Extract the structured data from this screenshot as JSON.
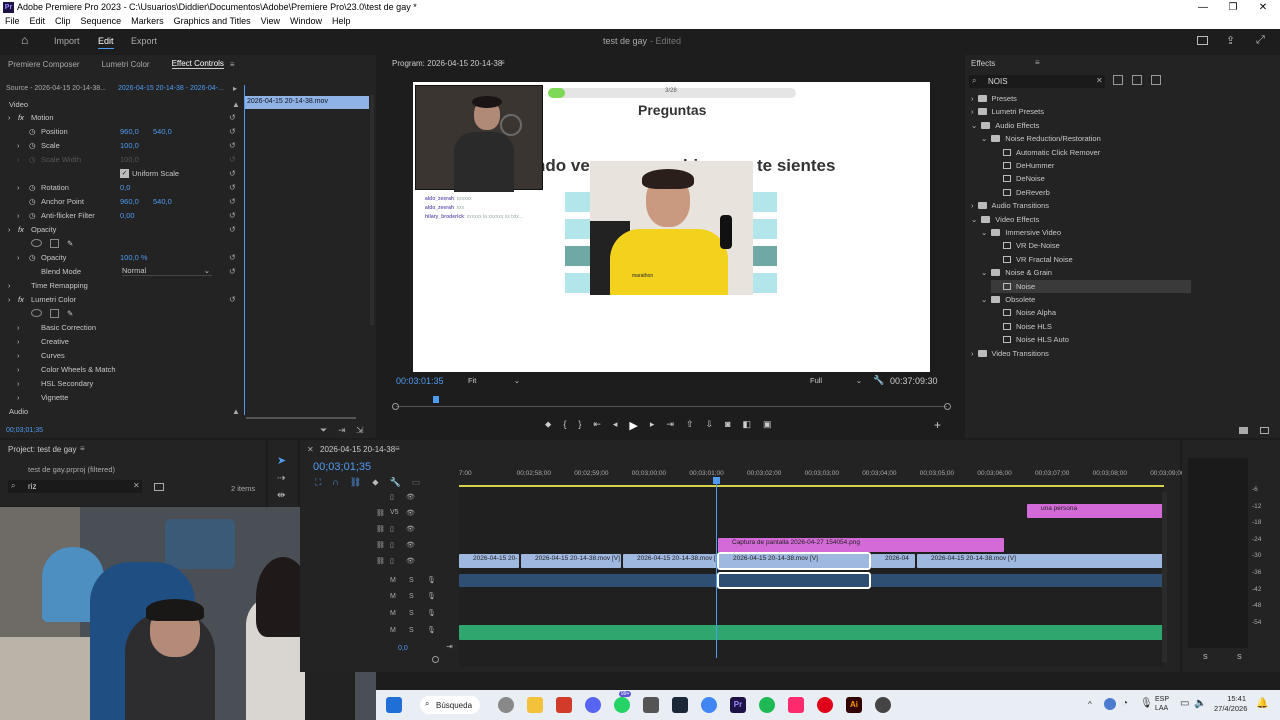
{
  "titlebar": {
    "title": "Adobe Premiere Pro 2023 - C:\\Usuarios\\Diddier\\Documentos\\Adobe\\Premiere Pro\\23.0\\test de gay *",
    "minimize": "—",
    "restore": "❐",
    "close": "✕",
    "app_icon": "Pr"
  },
  "menu": [
    "File",
    "Edit",
    "Clip",
    "Sequence",
    "Markers",
    "Graphics and Titles",
    "View",
    "Window",
    "Help"
  ],
  "workspace": {
    "tabs": [
      "Import",
      "Edit",
      "Export"
    ],
    "active": "Edit",
    "project_title": "test de gay",
    "status": "- Edited"
  },
  "left_tabs": [
    "Premiere Composer",
    "Lumetri Color",
    "Effect Controls"
  ],
  "effect_controls": {
    "source": "Source - 2026-04-15 20-14-38...",
    "clip": "2026-04-15 20-14-38 - 2026-04-...",
    "clip_bar": "2026-04-15 20-14-38.mov",
    "section_video": "Video",
    "motion": "Motion",
    "position_label": "Position",
    "position_x": "960,0",
    "position_y": "540,0",
    "scale_label": "Scale",
    "scale_value": "100,0",
    "scale_width_label": "Scale Width",
    "scale_width_value": "100,0",
    "uniform_scale": "Uniform Scale",
    "rotation_label": "Rotation",
    "rotation_value": "0,0",
    "anchor_label": "Anchor Point",
    "anchor_x": "960,0",
    "anchor_y": "540,0",
    "antiflicker_label": "Anti-flicker Filter",
    "antiflicker_value": "0,00",
    "opacity": "Opacity",
    "opacity_label": "Opacity",
    "opacity_value": "100,0 %",
    "blend_label": "Blend Mode",
    "blend_value": "Normal",
    "time_remap": "Time Remapping",
    "lumetri": "Lumetri Color",
    "lumetri_items": [
      "Basic Correction",
      "Creative",
      "Curves",
      "Color Wheels & Match",
      "HSL Secondary",
      "Vignette"
    ],
    "section_audio": "Audio",
    "timecode": "00;03;01;35"
  },
  "program": {
    "title": "Program: 2026-04-15 20-14-38",
    "timecode": "00:03:01:35",
    "fit": "Fit",
    "quality": "Full",
    "duration": "00:37:09:30",
    "slide_counter": "3/28",
    "slide_title": "Preguntas",
    "slide_text_left": "ndo ve",
    "slide_text_mid": "bi",
    "slide_text_right": "te sientes",
    "chat": [
      {
        "user": "aldo_zeerah",
        "msg": ": xxxxxx"
      },
      {
        "user": "aldo_zeerah",
        "msg": ": xxx"
      },
      {
        "user": "hilary_broderick",
        "msg": ": xxxxxx la xxxxxx xx txtx..."
      }
    ],
    "shirt_text": "marathon",
    "progress_pct": 0.07
  },
  "effects": {
    "title": "Effects",
    "search": "NOIS",
    "tree": [
      {
        "label": "Presets",
        "level": 0,
        "type": "folder"
      },
      {
        "label": "Lumetri Presets",
        "level": 0,
        "type": "folder"
      },
      {
        "label": "Audio Effects",
        "level": 0,
        "type": "folder"
      },
      {
        "label": "Noise Reduction/Restoration",
        "level": 1,
        "type": "folder"
      },
      {
        "label": "Automatic Click Remover",
        "level": 2,
        "type": "fx"
      },
      {
        "label": "DeHummer",
        "level": 2,
        "type": "fx"
      },
      {
        "label": "DeNoise",
        "level": 2,
        "type": "fx"
      },
      {
        "label": "DeReverb",
        "level": 2,
        "type": "fx"
      },
      {
        "label": "Audio Transitions",
        "level": 0,
        "type": "folder"
      },
      {
        "label": "Video Effects",
        "level": 0,
        "type": "folder"
      },
      {
        "label": "Immersive Video",
        "level": 1,
        "type": "folder"
      },
      {
        "label": "VR De-Noise",
        "level": 2,
        "type": "fx"
      },
      {
        "label": "VR Fractal Noise",
        "level": 2,
        "type": "fx"
      },
      {
        "label": "Noise & Grain",
        "level": 1,
        "type": "folder"
      },
      {
        "label": "Noise",
        "level": 2,
        "type": "fx"
      },
      {
        "label": "Obsolete",
        "level": 1,
        "type": "folder"
      },
      {
        "label": "Noise Alpha",
        "level": 2,
        "type": "fx"
      },
      {
        "label": "Noise HLS",
        "level": 2,
        "type": "fx"
      },
      {
        "label": "Noise HLS Auto",
        "level": 2,
        "type": "fx"
      },
      {
        "label": "Video Transitions",
        "level": 0,
        "type": "folder"
      }
    ]
  },
  "project": {
    "title": "Project: test de gay",
    "file": "test de gay.prproj (filtered)",
    "search": "riz",
    "count": "2 items"
  },
  "timeline": {
    "tab": "2026-04-15 20-14-38",
    "timecode": "00;03;01;35",
    "ruler": [
      "7:00",
      "00;02;58;00",
      "00;02;59;00",
      "00;03;00;00",
      "00;03;01;00",
      "00;03;02;00",
      "00;03;03;00",
      "00;03;04;00",
      "00;03;05;00",
      "00;03;06;00",
      "00;03;07;00",
      "00;03;08;00",
      "00;03;09;00"
    ],
    "clip_pink_top": "una persona",
    "clip_pink_mid": "Captura de pantalla 2026-04-27 154054.png",
    "video_clips": [
      "2026-04-15 20-",
      "2026-04-15 20-14-38.mov [V]",
      "2026-04-15 20-14-38.mov [",
      "2026-04-15 20-14-38.mov [V]",
      "2026-04",
      "2026-04-15 20-14-38.mov [V]"
    ],
    "track_v": "V5",
    "zero": "0,0"
  },
  "meter_scale": [
    "-6",
    "-12",
    "-18",
    "-24",
    "-30",
    "-36",
    "-42",
    "-48",
    "-54"
  ],
  "meter_s": [
    "S",
    "S"
  ],
  "taskbar": {
    "search": "Búsqueda",
    "lang1": "ESP",
    "lang2": "LAA",
    "time": "15:41",
    "date": "27/4/2026",
    "badge": "99+"
  }
}
